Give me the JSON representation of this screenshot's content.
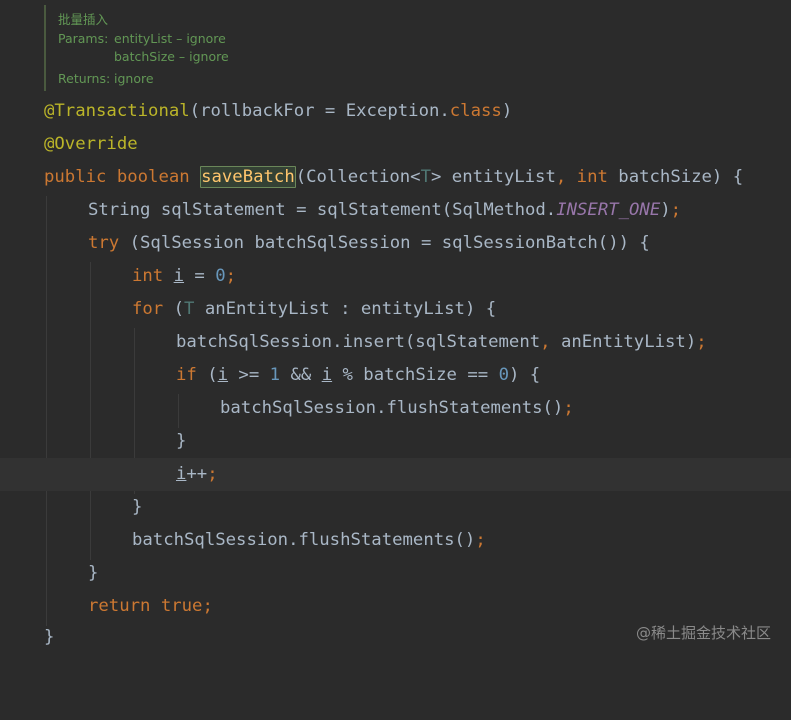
{
  "doc": {
    "title": "批量插入",
    "params_label": "Params:",
    "param1": "entityList – ignore",
    "param2": "batchSize – ignore",
    "returns_label": "Returns:",
    "returns_value": "ignore"
  },
  "code": {
    "ann_transactional": "@Transactional",
    "transactional_args_a": "(rollbackFor = Exception.",
    "transactional_class": "class",
    "transactional_args_b": ")",
    "ann_override": "@Override",
    "public": "public",
    "boolean": "boolean",
    "method_name": "saveBatch",
    "sig_a": "(Collection<",
    "type_param": "T",
    "sig_b": "> entityList",
    "comma": ",",
    "int": "int",
    "sig_c": " batchSize) {",
    "l4_a": "String sqlStatement = sqlStatement(SqlMethod.",
    "l4_const": "INSERT_ONE",
    "l4_b": ")",
    "semicolon": ";",
    "try": "try",
    "l5_rest": " (SqlSession batchSqlSession = sqlSessionBatch()) {",
    "var_i": "i",
    "eq": " = ",
    "zero": "0",
    "for": "for",
    "paren_open": " (",
    "l7_rest": " anEntityList : entityList) {",
    "l8_a": "batchSqlSession.insert(sqlStatement",
    "l8_b": " anEntityList)",
    "if": "if",
    "ge": " >= ",
    "one": "1",
    "and": " && ",
    "mod": " % batchSize == ",
    "close_brace_paren": ") {",
    "flush_call": "batchSqlSession.flushStatements()",
    "close_brace": "}",
    "incr": "++",
    "return": "return",
    "true": "true"
  },
  "watermark": "@稀土掘金技术社区"
}
